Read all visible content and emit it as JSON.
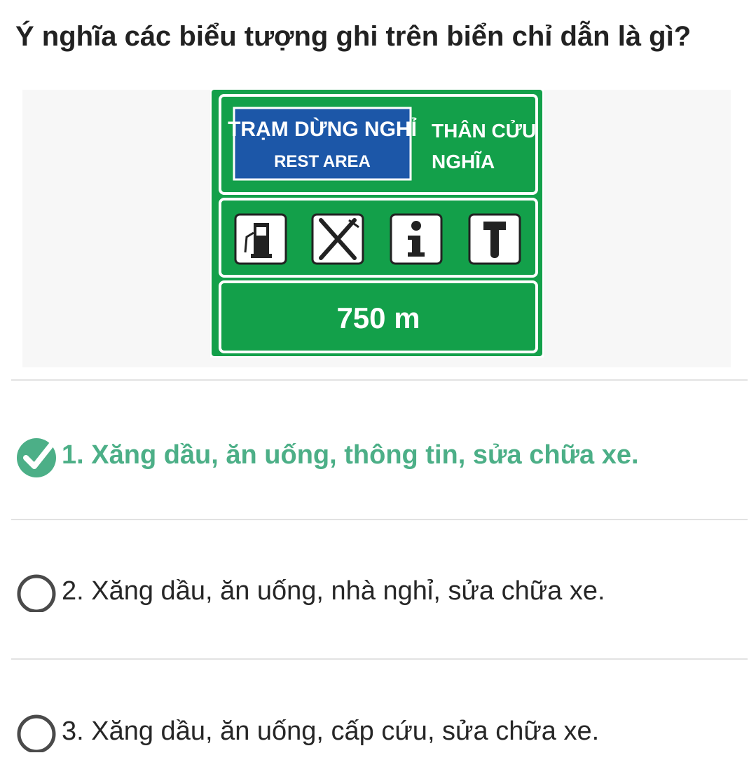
{
  "question": {
    "text": "Ý nghĩa các biểu tượng ghi trên biển chỉ dẫn là gì?"
  },
  "sign": {
    "blue_panel_line1": "TRẠM DỪNG NGHỈ",
    "blue_panel_line2": "REST AREA",
    "location_line1": "THÂN CỬU",
    "location_line2": "NGHĨA",
    "icons": [
      "fuel-pump-icon",
      "fork-knife-icon",
      "info-icon",
      "wrench-icon"
    ],
    "distance": "750 m",
    "colors": {
      "green": "#13a04a",
      "blue": "#1c57a8",
      "white": "#ffffff"
    }
  },
  "options": [
    {
      "label": "1. Xăng dầu, ăn uống, thông tin, sửa chữa xe.",
      "state": "correct"
    },
    {
      "label": "2. Xăng dầu, ăn uống, nhà nghỉ, sửa chữa xe.",
      "state": "unselected"
    },
    {
      "label": "3. Xăng dầu, ăn uống, cấp cứu, sửa chữa xe.",
      "state": "unselected"
    }
  ],
  "colors": {
    "correct_green": "#4caf87",
    "radio_border": "#4a4a4a",
    "divider": "#e2e2e2"
  }
}
